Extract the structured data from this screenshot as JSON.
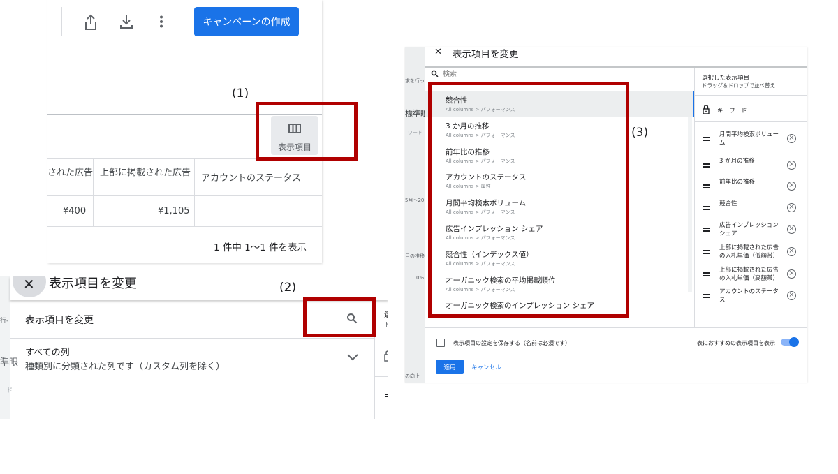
{
  "panel1": {
    "create_campaign": "キャンペーンの作成",
    "columns_button_label": "表示項目",
    "headers": [
      "された広告",
      "上部に掲載された広告",
      "アカウントのステータス"
    ],
    "row_values": [
      "¥400",
      "¥1,105",
      ""
    ],
    "pagination": "1 件中 1〜1 件を表示",
    "step_label": "(1)"
  },
  "panel2": {
    "header_title": "表示項目を変更",
    "title": "表示項目を変更",
    "section_title": "すべての列",
    "section_desc": "種類別に分類された列です（カスタム列を除く）",
    "step_label": "(2)",
    "left_cut_1": "行-",
    "left_cut_2": "準眼",
    "left_cut_3": "ード",
    "right_cut_1": "選",
    "right_cut_2": "ト"
  },
  "panel3": {
    "title": "表示項目を変更",
    "search_placeholder": "検索",
    "step_label": "(3)",
    "available_columns": [
      {
        "title": "競合性",
        "subtitle": "All columns > パフォーマンス"
      },
      {
        "title": "3 か月の推移",
        "subtitle": "All columns > パフォーマンス"
      },
      {
        "title": "前年比の推移",
        "subtitle": "All columns > パフォーマンス"
      },
      {
        "title": "アカウントのステータス",
        "subtitle": "All columns > 属性"
      },
      {
        "title": "月間平均検索ボリューム",
        "subtitle": "All columns > パフォーマンス"
      },
      {
        "title": "広告インプレッション シェア",
        "subtitle": "All columns > パフォーマンス"
      },
      {
        "title": "競合性（インデックス値）",
        "subtitle": "All columns > パフォーマンス"
      },
      {
        "title": "オーガニック検索の平均掲載順位",
        "subtitle": "All columns > パフォーマンス"
      },
      {
        "title": "オーガニック検索のインプレッション シェア",
        "subtitle": ""
      }
    ],
    "selected_header": "選択した表示項目",
    "selected_subheader": "ドラッグ＆ドロップで並べ替え",
    "locked_item": "キーワード",
    "selected_columns": [
      "月間平均検索ボリューム",
      "3 か月の推移",
      "前年比の推移",
      "競合性",
      "広告インプレッション シェア",
      "上部に掲載された広告の入札単価（低額帯）",
      "上部に掲載された広告の入札単価（高額帯）",
      "アカウントのステータス"
    ],
    "save_checkbox_label": "表示項目の設定を保存する（名前は必須です）",
    "recommended_toggle_label": "表におすすめの表示項目を表示",
    "apply_label": "適用",
    "cancel_label": "キャンセル",
    "bg_text": [
      "求を行っ",
      "標準眼",
      "ワード",
      "5月〜20",
      "目の推移",
      "0%",
      "の向上"
    ]
  }
}
